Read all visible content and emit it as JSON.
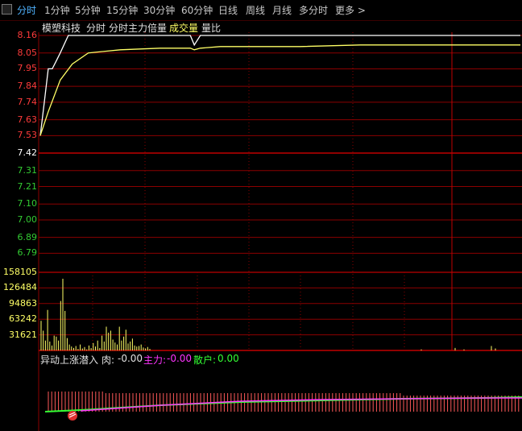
{
  "tabs": [
    {
      "label": "分时",
      "active": true
    },
    {
      "label": "1分钟"
    },
    {
      "label": "5分钟"
    },
    {
      "label": "15分钟"
    },
    {
      "label": "30分钟"
    },
    {
      "label": "60分钟"
    },
    {
      "label": "日线"
    },
    {
      "label": "周线"
    },
    {
      "label": "月线"
    },
    {
      "label": "多分时"
    },
    {
      "label": "更多 >"
    }
  ],
  "header": {
    "stock_name": "模塑科技",
    "mode": "分时",
    "multiplier": "分时主力倍量",
    "volume_label": "成交量",
    "ratio_label": "量比"
  },
  "indicator": {
    "name": "异动上涨潜入",
    "meat_label": "肉:",
    "meat_value": "-0.00",
    "main_label": "主力:",
    "main_value": "-0.00",
    "retail_label": "散户:",
    "retail_value": "0.00"
  },
  "colors": {
    "up": "#ff3b3b",
    "down": "#33cc33",
    "grid": "#8b0000",
    "price": "#ffffff",
    "avg": "#ffff66"
  },
  "chart_data": {
    "type": "line",
    "price_axis": {
      "ticks": [
        "8.16",
        "8.05",
        "7.95",
        "7.84",
        "7.74",
        "7.63",
        "7.53",
        "7.42",
        "7.31",
        "7.21",
        "7.10",
        "7.00",
        "6.89",
        "6.79"
      ],
      "prev_close": 7.42
    },
    "volume_axis": {
      "ticks": [
        "158105",
        "126484",
        "94863",
        "63242",
        "31621"
      ]
    },
    "series": [
      {
        "name": "price",
        "x": [
          0,
          2,
          4,
          6,
          8,
          10,
          14,
          18,
          20,
          22,
          24,
          30,
          60,
          75,
          77,
          80,
          90,
          130,
          240
        ],
        "y": [
          7.53,
          7.74,
          7.95,
          7.95,
          8.0,
          8.05,
          8.16,
          8.16,
          8.16,
          8.16,
          8.16,
          8.16,
          8.16,
          8.16,
          8.1,
          8.16,
          8.16,
          8.16,
          8.16
        ]
      },
      {
        "name": "average",
        "x": [
          0,
          4,
          10,
          16,
          24,
          40,
          60,
          75,
          77,
          80,
          90,
          130,
          160,
          240
        ],
        "y": [
          7.53,
          7.68,
          7.88,
          7.98,
          8.05,
          8.07,
          8.08,
          8.08,
          8.07,
          8.08,
          8.09,
          8.09,
          8.1,
          8.1
        ]
      }
    ],
    "volume": [
      60000,
      40000,
      20000,
      82000,
      18000,
      10000,
      30000,
      28000,
      20000,
      100000,
      145000,
      80000,
      25000,
      12000,
      8000,
      5000,
      9000,
      3000,
      12000,
      4000,
      7000,
      2000,
      10000,
      5000,
      15000,
      8000,
      20000,
      5000,
      30000,
      18000,
      48000,
      36000,
      40000,
      22000,
      16000,
      12000,
      48000,
      20000,
      28000,
      42000,
      14000,
      18000,
      24000,
      10000,
      8000,
      9000,
      12000,
      6000,
      4000,
      7000,
      3000
    ]
  }
}
